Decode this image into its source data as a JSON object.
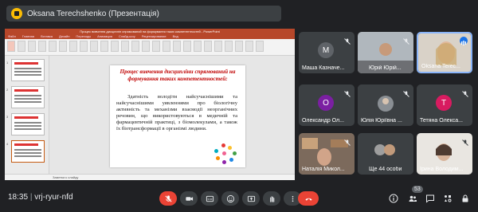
{
  "presenter_bar": {
    "label": "Oksana Terechshenko (Презентація)"
  },
  "powerpoint": {
    "window_title": "Процес вивчення дисциплін спрямований на формування таких компетентностей - PowerPoint",
    "tabs": [
      "Файл",
      "Главная",
      "Вставка",
      "Дизайн",
      "Переходы",
      "Анимация",
      "Слайд-шоу",
      "Рецензирование",
      "Вид"
    ],
    "slide_numbers": [
      "1",
      "2",
      "3",
      "4"
    ],
    "status_text": "Заметки к слайду"
  },
  "slide": {
    "title": "Процес вивчення дисципліни спрямований на формування таких компетентностей:",
    "body": "Здатність володіти найсучаснішими та найсучаснішими уявленнями про біологічну активність та механізми взаємодії неорганічних речовин, що використовуються в медичній та фармацевтичній практиці, з біомолекулами, а також їх біотрансформації в організмі людини."
  },
  "participants": [
    {
      "name": "Маша Казначе...",
      "initial": "М",
      "color": "#5f6368",
      "muted": true
    },
    {
      "name": "Юрій Юрій...",
      "initial": "",
      "color": "#5f6368",
      "muted": true
    },
    {
      "name": "Oksana Terec...",
      "initial": "",
      "color": "#5f6368",
      "muted": false
    },
    {
      "name": "Олександр Ол...",
      "initial": "О",
      "color": "#7b1fa2",
      "muted": true
    },
    {
      "name": "Юлія Юріївна ...",
      "initial": "",
      "color": "#5f6368",
      "muted": true
    },
    {
      "name": "Тетяна Олекса...",
      "initial": "Т",
      "color": "#d81b60",
      "muted": true
    },
    {
      "name": "Наталія Микол...",
      "initial": "",
      "color": "#5f6368",
      "muted": true
    },
    {
      "name": "Ще 44 особи",
      "initial": "",
      "color": "#5f6368",
      "muted": false
    },
    {
      "name": "Ірина Володим...",
      "initial": "",
      "color": "#5f6368",
      "muted": true
    }
  ],
  "bottom_bar": {
    "time": "18:35",
    "meeting_code": "vrj-ryur-nfd",
    "participant_count": "53"
  },
  "icons": [
    "mic-off-icon",
    "camera-off-icon",
    "captions-icon",
    "emoji-icon",
    "present-icon",
    "raise-hand-icon",
    "more-icon",
    "end-call-icon",
    "info-icon",
    "people-icon",
    "chat-icon",
    "activities-icon",
    "lock-icon"
  ]
}
